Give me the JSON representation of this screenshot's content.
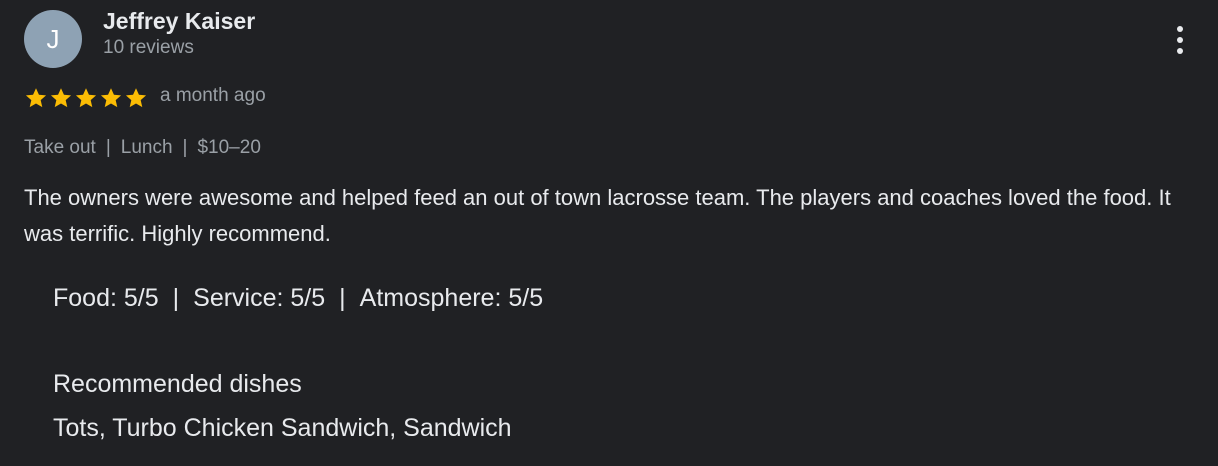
{
  "review": {
    "author": {
      "initial": "J",
      "name": "Jeffrey Kaiser",
      "reviews_count": "10 reviews"
    },
    "rating": {
      "stars": 5,
      "max_stars": 5,
      "star_color": "#fbbc04"
    },
    "date": "a month ago",
    "meta": {
      "service_type": "Take out",
      "meal_type": "Lunch",
      "price": "$10–20",
      "separator": "|"
    },
    "text": "The owners were awesome and helped feed an out of town lacrosse team. The players and coaches loved the food. It was terrific. Highly recommend.",
    "sub_ratings": {
      "food": "Food: 5/5",
      "service": "Service: 5/5",
      "atmosphere": "Atmosphere: 5/5",
      "separator": "|"
    },
    "recommended_dishes": {
      "heading": "Recommended dishes",
      "list": "Tots, Turbo Chicken Sandwich, Sandwich"
    }
  },
  "icons": {
    "more": "more-vert-icon",
    "star": "star-icon"
  },
  "colors": {
    "background": "#202124",
    "primary_text": "#e8eaed",
    "secondary_text": "#9aa0a6",
    "avatar_bg": "#8ea2b4"
  }
}
